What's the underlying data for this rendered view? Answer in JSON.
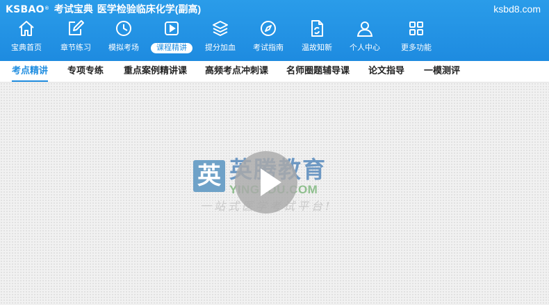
{
  "header": {
    "logo": "KSBAO",
    "logo_mark": "®",
    "app_name": "考试宝典",
    "title": "医学检验临床化学(副高)",
    "domain": "ksbd8.com"
  },
  "nav": {
    "items": [
      {
        "label": "宝典首页",
        "icon": "home-icon"
      },
      {
        "label": "章节练习",
        "icon": "edit-icon"
      },
      {
        "label": "模拟考场",
        "icon": "clock-icon"
      },
      {
        "label": "课程精讲",
        "icon": "video-play-icon",
        "active": true
      },
      {
        "label": "提分加血",
        "icon": "layers-icon"
      },
      {
        "label": "考试指南",
        "icon": "compass-icon"
      },
      {
        "label": "温故知新",
        "icon": "refresh-document-icon"
      },
      {
        "label": "个人中心",
        "icon": "user-icon"
      },
      {
        "label": "更多功能",
        "icon": "grid-icon"
      }
    ]
  },
  "subnav": {
    "tabs": [
      {
        "label": "考点精讲",
        "active": true
      },
      {
        "label": "专项专练"
      },
      {
        "label": "重点案例精讲课"
      },
      {
        "label": "高频考点冲刺课"
      },
      {
        "label": "名师圈题辅导课"
      },
      {
        "label": "论文指导"
      },
      {
        "label": "一模测评"
      }
    ]
  },
  "player": {
    "watermark_badge": "英",
    "watermark_name": "英腾教育",
    "watermark_url": "YINGEDU.COM",
    "watermark_slogan": "一站式医学考试平台!"
  },
  "colors": {
    "header_blue": "#1f8de0",
    "active_tab_text": "#1f8de0"
  }
}
